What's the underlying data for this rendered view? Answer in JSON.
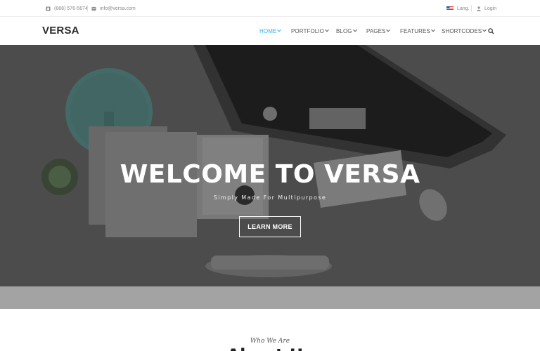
{
  "topbar": {
    "phone": "(888) 576-5674",
    "email": "info@versa.com",
    "lang": "Lang.",
    "login": "Login"
  },
  "header": {
    "logo": "VERSA",
    "nav": [
      {
        "label": "HOME",
        "active": true
      },
      {
        "label": "PORTFOLIO",
        "active": false
      },
      {
        "label": "BLOG",
        "active": false
      },
      {
        "label": "PAGES",
        "active": false
      },
      {
        "label": "FEATURES",
        "active": false
      },
      {
        "label": "SHORTCODES",
        "active": false
      }
    ]
  },
  "hero": {
    "title": "WELCOME TO VERSA",
    "subtitle": "Simply Made For Multipurpose",
    "button": "LEARN MORE"
  },
  "section": {
    "eyebrow": "Who We Are",
    "heading": "About Us"
  },
  "colors": {
    "accent": "#3bb0e3",
    "text_dark": "#2b2b2b",
    "hero_overlay": "#5a5a5a",
    "strip": "#a3a3a3"
  },
  "icons": [
    "phone-icon",
    "envelope-icon",
    "us-flag-icon",
    "user-icon",
    "chevron-down-icon",
    "search-icon"
  ]
}
